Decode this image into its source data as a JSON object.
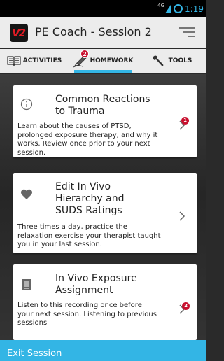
{
  "status_bar": {
    "network": "4G",
    "time": "1:19"
  },
  "app": {
    "title": "PE Coach - Session 2",
    "logo_text": "V2"
  },
  "tabs": [
    {
      "label": "ACTIVITIES",
      "icon": "book-icon",
      "badge": ""
    },
    {
      "label": "HOMEWORK",
      "icon": "pencil-icon",
      "badge": "2"
    },
    {
      "label": "TOOLS",
      "icon": "wrench-icon",
      "badge": ""
    }
  ],
  "cards": [
    {
      "title_line1": "Common Reactions",
      "title_line2": "to Trauma",
      "title_line3": "",
      "description": "Learn about the causes of PTSD, prolonged exposure therapy, and why it works. Review once prior to your next session.",
      "icon": "info-icon",
      "badge": "1"
    },
    {
      "title_line1": "Edit In Vivo",
      "title_line2": "Hierarchy and",
      "title_line3": "SUDS Ratings",
      "description": "Three times a day, practice the relaxation exercise your therapist taught you in your last session.",
      "icon": "heart-icon",
      "badge": ""
    },
    {
      "title_line1": "In Vivo Exposure",
      "title_line2": "Assignment",
      "title_line3": "",
      "description": "Listen to this recording once before your next session. Listening to previous sessions",
      "icon": "document-icon",
      "badge": "2"
    }
  ],
  "bottom_bar": {
    "label": "Exit Session"
  },
  "colors": {
    "accent": "#33b5e5",
    "badge": "#c8102e"
  }
}
